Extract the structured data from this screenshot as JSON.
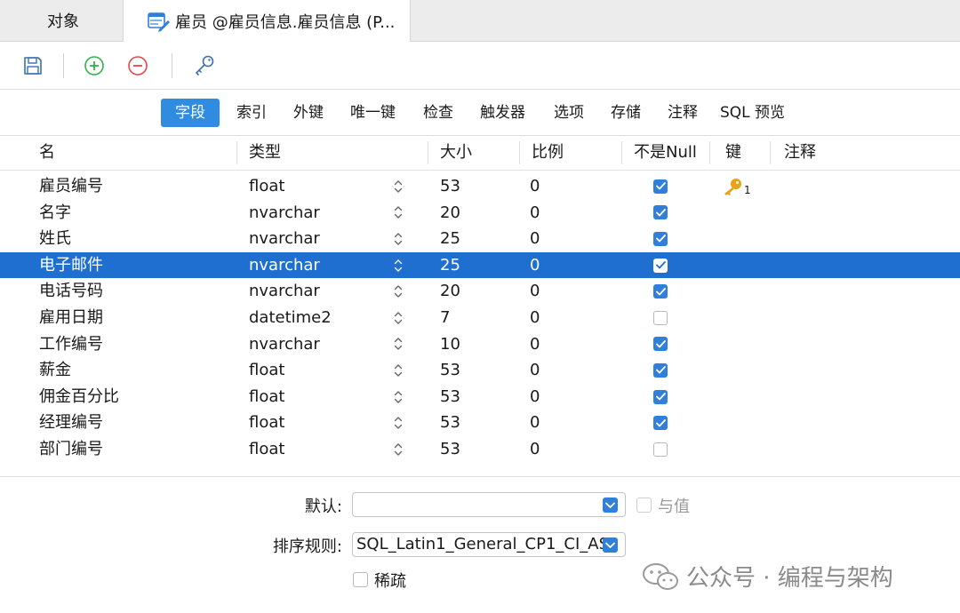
{
  "tabs": {
    "objects_label": "对象",
    "active_label": "雇员 @雇员信息.雇员信息 (P..."
  },
  "toolbar": {
    "buttons": [
      "save-icon",
      "add-field-icon",
      "remove-field-icon",
      "primary-key-icon"
    ]
  },
  "subtabs": [
    {
      "label": "字段",
      "active": true
    },
    {
      "label": "索引"
    },
    {
      "label": "外键"
    },
    {
      "label": "唯一键"
    },
    {
      "label": "检查"
    },
    {
      "label": "触发器"
    },
    {
      "label": "选项"
    },
    {
      "label": "存储"
    },
    {
      "label": "注释"
    },
    {
      "label": "SQL 预览"
    }
  ],
  "grid": {
    "headers": {
      "name": "名",
      "type": "类型",
      "size": "大小",
      "scale": "比例",
      "not_null": "不是Null",
      "key": "键",
      "comment": "注释"
    },
    "rows": [
      {
        "name": "雇员编号",
        "type": "float",
        "size": "53",
        "scale": "0",
        "not_null": true,
        "key": "1"
      },
      {
        "name": "名字",
        "type": "nvarchar",
        "size": "20",
        "scale": "0",
        "not_null": true,
        "key": ""
      },
      {
        "name": "姓氏",
        "type": "nvarchar",
        "size": "25",
        "scale": "0",
        "not_null": true,
        "key": ""
      },
      {
        "name": "电子邮件",
        "type": "nvarchar",
        "size": "25",
        "scale": "0",
        "not_null": true,
        "key": "",
        "selected": true
      },
      {
        "name": "电话号码",
        "type": "nvarchar",
        "size": "20",
        "scale": "0",
        "not_null": true,
        "key": ""
      },
      {
        "name": "雇用日期",
        "type": "datetime2",
        "size": "7",
        "scale": "0",
        "not_null": false,
        "key": ""
      },
      {
        "name": "工作编号",
        "type": "nvarchar",
        "size": "10",
        "scale": "0",
        "not_null": true,
        "key": ""
      },
      {
        "name": "薪金",
        "type": "float",
        "size": "53",
        "scale": "0",
        "not_null": true,
        "key": ""
      },
      {
        "name": "佣金百分比",
        "type": "float",
        "size": "53",
        "scale": "0",
        "not_null": true,
        "key": ""
      },
      {
        "name": "经理编号",
        "type": "float",
        "size": "53",
        "scale": "0",
        "not_null": true,
        "key": ""
      },
      {
        "name": "部门编号",
        "type": "float",
        "size": "53",
        "scale": "0",
        "not_null": false,
        "key": ""
      }
    ]
  },
  "props": {
    "default_label": "默认:",
    "default_value": "",
    "binding_label": "与值",
    "collation_label": "排序规则:",
    "collation_value": "SQL_Latin1_General_CP1_CI_AS",
    "sparse_label": "稀疏"
  },
  "watermark": {
    "text": "公众号 · 编程与架构"
  },
  "colors": {
    "accent": "#2f8ce0",
    "selection": "#1f6fd0",
    "add_green": "#2db34a",
    "remove_red": "#e04848",
    "key_gold": "#e8a317"
  }
}
